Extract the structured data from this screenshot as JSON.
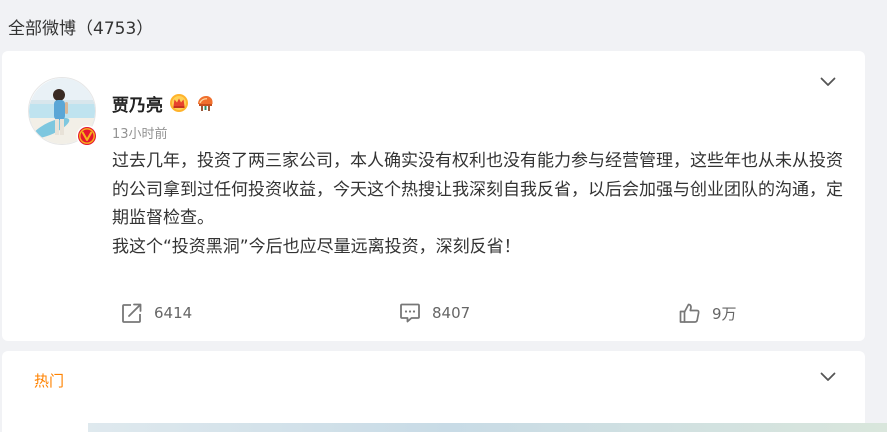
{
  "page": {
    "section_title": "全部微博（4753）"
  },
  "post": {
    "author": {
      "name": "贾乃亮",
      "avatar_icon": "avatar-photo",
      "verified_icon": "verified-v-badge",
      "badge_icons": [
        "crown-vip-icon",
        "fan-badge-icon"
      ]
    },
    "timestamp": "13小时前",
    "paragraphs": [
      "过去几年，投资了两三家公司，本人确实没有权利也没有能力参与经营管理，这些年也从未从投资的公司拿到过任何投资收益，今天这个热搜让我深刻自我反省，以后会加强与创业团队的沟通，定期监督检查。",
      "我这个“投资黑洞”今后也应尽量远离投资，深刻反省！"
    ],
    "actions": {
      "repost": {
        "icon": "share-icon",
        "count": "6414"
      },
      "comment": {
        "icon": "comment-icon",
        "count": "8407"
      },
      "like": {
        "icon": "thumbs-up-icon",
        "count": "9万"
      }
    }
  },
  "hot_comments": {
    "label": "热门"
  },
  "colors": {
    "accent": "#ff8200",
    "background": "#f1f2f5",
    "card": "#ffffff",
    "muted_text": "#939393",
    "verified": "#e6162d"
  }
}
